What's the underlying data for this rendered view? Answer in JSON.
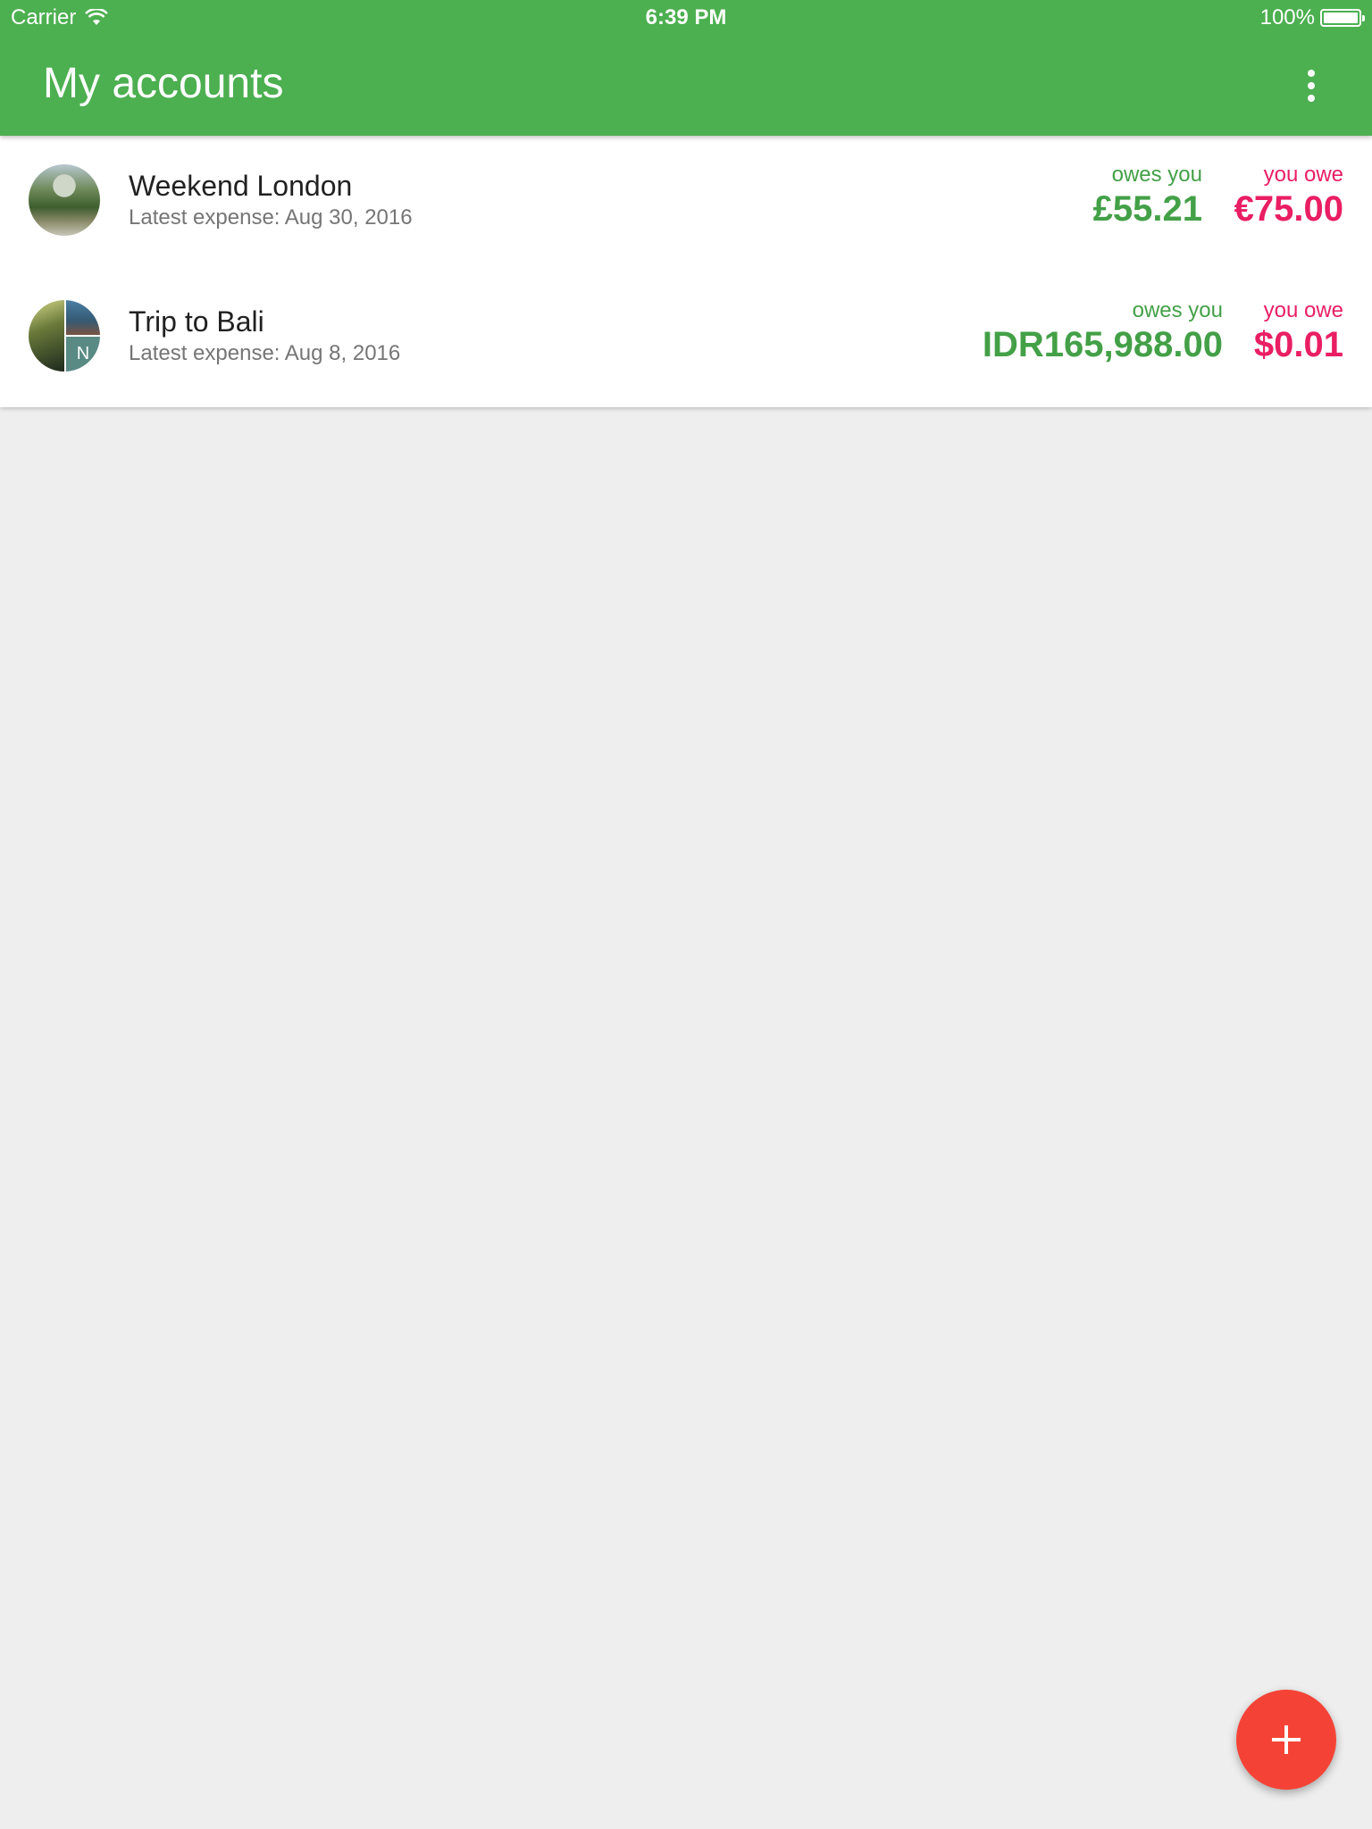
{
  "status_bar": {
    "carrier": "Carrier",
    "time": "6:39 PM",
    "battery": "100%",
    "battery_level": 1.0
  },
  "app_bar": {
    "title": "My accounts",
    "menu_icon": "more-vert-icon"
  },
  "accounts": [
    {
      "name": "Weekend London",
      "latest_expense": "Latest expense: Aug 30, 2016",
      "owes_you_label": "owes you",
      "owes_you_amount": "£55.21",
      "you_owe_label": "you owe",
      "you_owe_amount": "€75.00"
    },
    {
      "name": "Trip to Bali",
      "latest_expense": "Latest expense: Aug 8, 2016",
      "owes_you_label": "owes you",
      "owes_you_amount": "IDR165,988.00",
      "you_owe_label": "you owe",
      "you_owe_amount": "$0.01",
      "avatar_initial": "N"
    }
  ],
  "fab": {
    "icon": "plus-icon"
  },
  "colors": {
    "primary": "#4caf50",
    "positive": "#43a047",
    "negative": "#e91e63",
    "fab": "#f44336",
    "background": "#eeeeee"
  }
}
